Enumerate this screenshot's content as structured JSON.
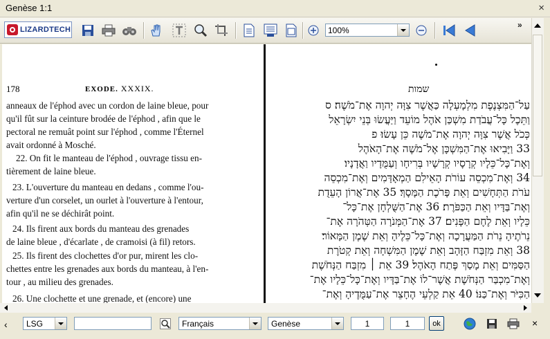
{
  "window": {
    "title": "Genèse 1:1",
    "close_glyph": "×"
  },
  "toolbar": {
    "logo_text": "LIZARDTECH",
    "zoom_value": "100%",
    "more_glyph": "»",
    "icons": [
      "save-icon",
      "print-icon",
      "binoculars-icon",
      "hand-tool-icon",
      "text-select-icon",
      "zoom-tool-icon",
      "crop-icon",
      "single-page-icon",
      "fit-width-icon",
      "fit-page-icon",
      "zoom-in-icon",
      "zoom-out-icon",
      "first-page-icon",
      "previous-page-icon"
    ]
  },
  "document": {
    "left": {
      "page_number": "178",
      "running_head_book": "EXODE.",
      "running_head_chapter": "XXXIX.",
      "lines": [
        "anneaux de l'éphod avec un cordon de laine bleue, pour",
        "qu'il fût sur la ceinture brodée de l'éphod , afin que le",
        "pectoral ne remuât point sur l'éphod , comme l'Éternel",
        "avait ordonné à Mosché.",
        "22. On fit le manteau de l'éphod , ouvrage tissu en-",
        "tièrement de laine bleue.",
        "23. L'ouverture du manteau en dedans , comme l'ou-",
        "verture d'un corselet, un ourlet à l'ouverture à l'entour,",
        "afin qu'il ne se déchirât point.",
        "24. Ils firent aux bords du manteau des grenades",
        "de laine bleue , d'écarlate , de cramoisi (à fil) retors.",
        "25. Ils firent des clochettes d'or pur, mirent les clo-",
        "chettes entre les grenades aux bords du manteau, à l'en-",
        "tour , au milieu des grenades.",
        "26. Une clochette et une grenade, et (encore) une"
      ]
    },
    "right": {
      "title": "שמות",
      "lines": [
        "עַל־הַמִּצְנֶפֶת מִלְמָעְלָה כַּאֲשֶׁר צִוָּה יְהוָה אֶת־מֹשֶׁה׃ ס",
        "וַתֵּכֶל כָּל־עֲבֹדַת מִשְׁכַּן אֹהֶל מוֹעֵד וַיַּעֲשׂוּ בְּנֵי יִשְׂרָאֵל",
        "כְּכֹל אֲשֶׁר צִוָּה יְהוָה אֶת־מֹשֶׁה כֵּן עָשׂוּ׃ פ",
        "33 וַיָּבִיאוּ אֶת־הַמִּשְׁכָּן אֶל־מֹשֶׁה אֶת־הָאֹהֶל",
        "וְאֶת־כָּל־כֵּלָיו קְרָסָיו קְרָשָׁיו בְּרִיחָו וְעַמֻּדָיו וַאֲדָנָיו׃",
        "34 וְאֶת־מִכְסֵה עוֹרֹת הָאֵילִם הַמְאָדָּמִים וְאֶת־מִכְסֵה",
        "עֹרֹת הַתְּחָשִׁים וְאֵת פָּרֹכֶת הַמָּסָךְ׃ 35 אֶת־אֲרוֹן הָעֵדֻת",
        "וְאֶת־בַּדָּיו וְאֵת הַכַּפֹּרֶת׃ 36 אֶת־הַשֻּׁלְחָן אֶת־כָּל־",
        "כֵּלָיו וְאֵת לֶחֶם הַפָּנִים׃ 37 אֶת־הַמְּנֹרָה הַטְּהֹרָה אֶת־",
        "נֵרֹתֶיהָ נֵרֹת הַמַּעֲרָכָה וְאֶת־כָּל־כֵּלֶיהָ וְאֵת שֶׁמֶן הַמָּאוֹר׃",
        "38 וְאֵת מִזְבַּח הַזָּהָב וְאֵת שֶׁמֶן הַמִּשְׁחָה וְאֵת קְטֹרֶת",
        "הַסַּמִּים וְאֵת מָסַךְ פֶּתַח הָאֹהֶל׃ 39 אֵת ׀ מִזְבַּח הַנְּחֹשֶׁת",
        "וְאֶת־מִכְבַּר הַנְּחֹשֶׁת אֲשֶׁר־לוֹ אֶת־בַּדָּיו וְאֶת־כָּל־כֵּלָיו אֶת־",
        "הַכִּיֹּר וְאֶת־כַּנּוֹ׃ 40 אֵת קַלְעֵי הֶחָצֵר אֶת־עַמֻּדֶיהָ וְאֶת־"
      ]
    }
  },
  "bottombar": {
    "prev_glyph": "‹",
    "version_select": "LSG",
    "search_value": "",
    "language_select": "Français",
    "book_select": "Genèse",
    "chapter_value": "1",
    "verse_value": "1",
    "ok_label": "ok",
    "close_glyph": "×"
  }
}
